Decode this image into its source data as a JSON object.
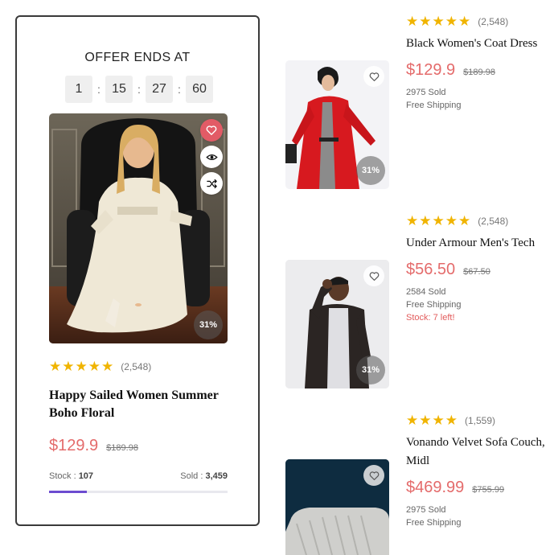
{
  "featured": {
    "offer_title": "OFFER ENDS AT",
    "timer": [
      "1",
      "15",
      "27",
      "60"
    ],
    "timer_sep": ":",
    "discount_badge": "31%",
    "side_icons": [
      "heart-icon",
      "eye-icon",
      "shuffle-icon"
    ],
    "rating_stars": 5,
    "rating_count": "(2,548)",
    "name": "Happy Sailed Women Summer Boho Floral",
    "price": "$129.9",
    "old_price": "$189.98",
    "stock_label": "Stock : ",
    "stock_value": "107",
    "sold_label": "Sold : ",
    "sold_value": "3,459",
    "progress_fraction": 0.21,
    "colors": {
      "accent_red": "#e25b66",
      "price": "#e46b6b",
      "progress": "#6c4cd0",
      "star": "#f0b400"
    }
  },
  "products": [
    {
      "rating_stars": 5,
      "rating_count": "(2,548)",
      "name": "Black Women's Coat Dress",
      "price": "$129.9",
      "old_price": "$189.98",
      "sold": "2975 Sold",
      "shipping": "Free Shipping",
      "stock_warning": "",
      "discount_badge": "31%"
    },
    {
      "rating_stars": 5,
      "rating_count": "(2,548)",
      "name": "Under Armour Men's Tech",
      "price": "$56.50",
      "old_price": "$67.50",
      "sold": "2584 Sold",
      "shipping": "Free Shipping",
      "stock_warning": "Stock: 7 left!",
      "discount_badge": "31%"
    },
    {
      "rating_stars": 4,
      "rating_count": "(1,559)",
      "name": "Vonando Velvet Sofa Couch, Midl",
      "price": "$469.99",
      "old_price": "$755.99",
      "sold": "2975 Sold",
      "shipping": "Free Shipping",
      "stock_warning": "",
      "discount_badge": ""
    }
  ]
}
